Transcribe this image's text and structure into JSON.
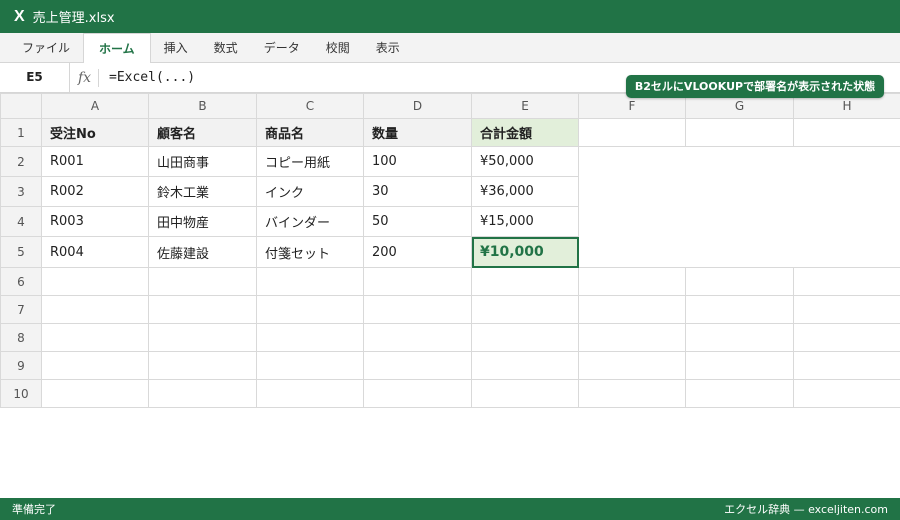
{
  "titlebar": {
    "logo": "X",
    "filename": "売上管理.xlsx"
  },
  "ribbon": {
    "tabs": [
      "ファイル",
      "ホーム",
      "挿入",
      "数式",
      "データ",
      "校閲",
      "表示"
    ],
    "active_tab": "ホーム"
  },
  "formula_bar": {
    "name_box": "E5",
    "fx": "fx",
    "formula": "=Excel(...)"
  },
  "callout": "B2セルにVLOOKUPで部署名が表示された状態",
  "grid": {
    "columns": [
      "A",
      "B",
      "C",
      "D",
      "E",
      "F",
      "G",
      "H"
    ],
    "rows": [
      "1",
      "2",
      "3",
      "4",
      "5",
      "6",
      "7",
      "8",
      "9",
      "10"
    ],
    "header": [
      "受注No",
      "顧客名",
      "商品名",
      "数量",
      "合計金額"
    ],
    "data": [
      [
        "R001",
        "山田商事",
        "コピー用紙",
        "100",
        "¥50,000"
      ],
      [
        "R002",
        "鈴木工業",
        "インク",
        "30",
        "¥36,000"
      ],
      [
        "R003",
        "田中物産",
        "バインダー",
        "50",
        "¥15,000"
      ],
      [
        "R004",
        "佐藤建設",
        "付箋セット",
        "200",
        "¥10,000"
      ]
    ],
    "selected_cell": "E5"
  },
  "status": {
    "left": "準備完了",
    "right": "エクセル辞典 — exceljiten.com"
  },
  "colors": {
    "accent": "#217346",
    "selected_fill": "#e2efda",
    "header_fill": "#f2f2f2"
  }
}
